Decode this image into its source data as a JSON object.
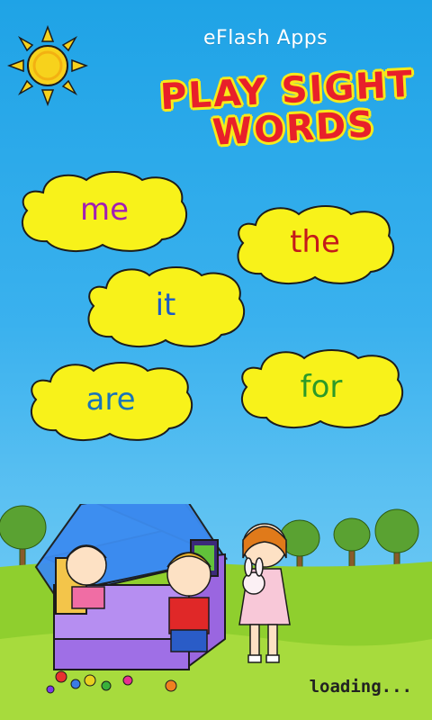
{
  "header": {
    "brand": "eFlash Apps",
    "title_line1": "PLAY SIGHT",
    "title_line2": "WORDS"
  },
  "words": [
    {
      "text": "me",
      "color": "#a21fb3"
    },
    {
      "text": "the",
      "color": "#c41a1a"
    },
    {
      "text": "it",
      "color": "#1c5bc7"
    },
    {
      "text": "are",
      "color": "#1a74b8"
    },
    {
      "text": "for",
      "color": "#2c9a28"
    }
  ],
  "status": {
    "loading": "loading..."
  },
  "colors": {
    "sky": "#3ab1ee",
    "cloud_fill": "#f8f21a",
    "grass": "#8fcf2e",
    "sun": "#f7d21c"
  }
}
